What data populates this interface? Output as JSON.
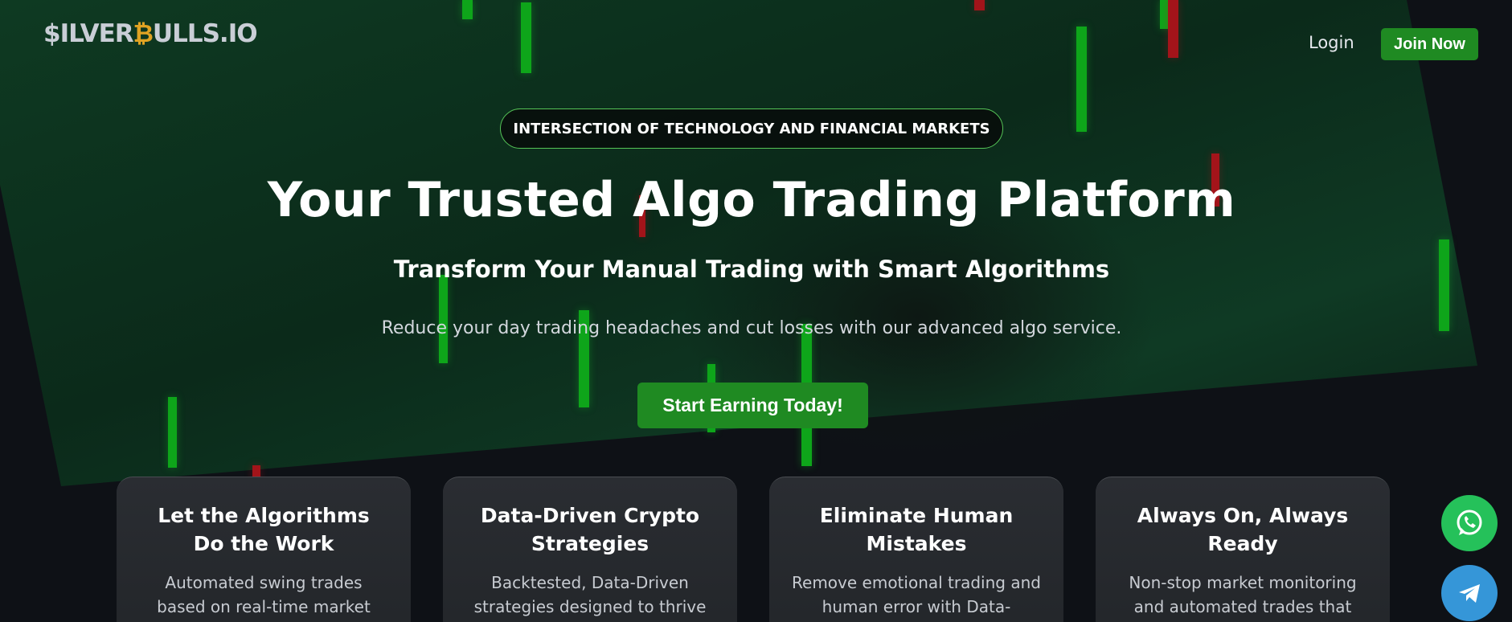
{
  "header": {
    "logo_prefix_dollar": "$",
    "logo_part1": "ILVER",
    "logo_coin": "₿",
    "logo_part2": "ULLS.IO",
    "login_label": "Login",
    "join_label": "Join Now"
  },
  "hero": {
    "pill_label": "INTERSECTION OF TECHNOLOGY AND FINANCIAL MARKETS",
    "title": "Your Trusted Algo Trading Platform",
    "subtitle": "Transform Your Manual Trading with Smart Algorithms",
    "description": "Reduce your day trading headaches and cut losses with our advanced algo service.",
    "cta_label": "Start Earning Today!"
  },
  "cards": [
    {
      "title": "Let the Algorithms Do the Work",
      "text": "Automated swing trades based on real-time market"
    },
    {
      "title": "Data-Driven Crypto Strategies",
      "text": "Backtested, Data-Driven strategies designed to thrive"
    },
    {
      "title": "Eliminate Human Mistakes",
      "text": "Remove emotional trading and human error with Data-"
    },
    {
      "title": "Always On, Always Ready",
      "text": "Non-stop market monitoring and automated trades that"
    }
  ],
  "floating": {
    "whatsapp_icon": "whatsapp-icon",
    "telegram_icon": "telegram-icon"
  },
  "colors": {
    "brand_green": "#1f8a22",
    "logo_gold": "#e0a323",
    "background": "#0e1116"
  }
}
